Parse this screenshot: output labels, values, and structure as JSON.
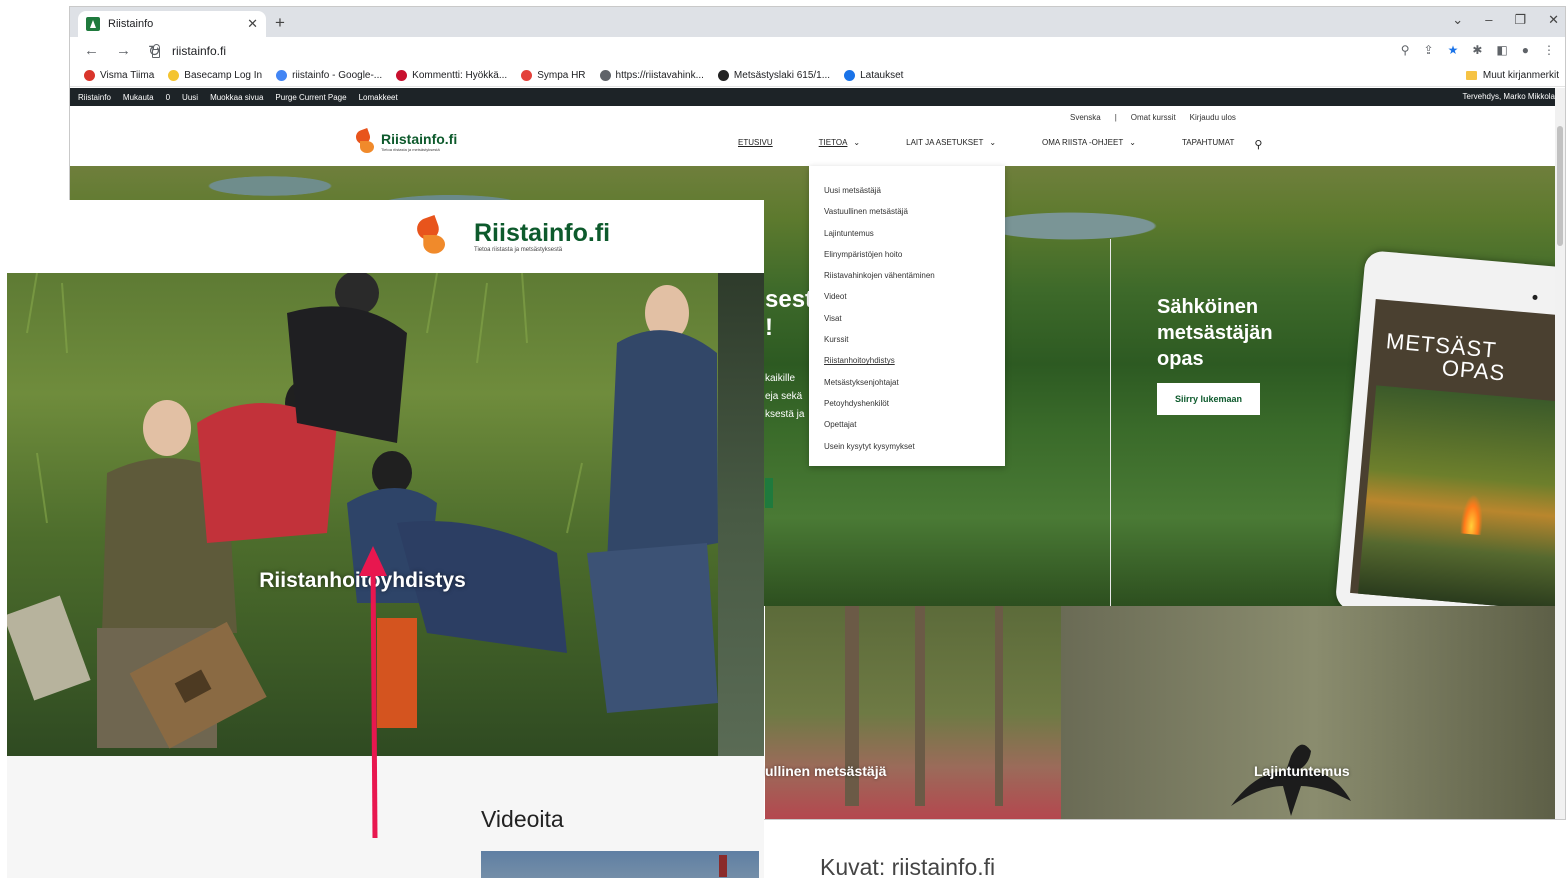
{
  "browser": {
    "tab_title": "Riistainfo",
    "address": "riistainfo.fi",
    "bookmarks": [
      {
        "label": "Visma Tiima",
        "color": "#d9352b"
      },
      {
        "label": "Basecamp Log In",
        "color": "#f4c430"
      },
      {
        "label": "riistainfo - Google-...",
        "color": "#4285f4"
      },
      {
        "label": "Kommentti: Hyökkä...",
        "color": "#c8102e"
      },
      {
        "label": "Sympa HR",
        "color": "#e3413a"
      },
      {
        "label": "https://riistavahink...",
        "color": "#5f6368"
      },
      {
        "label": "Metsästyslaki 615/1...",
        "color": "#222222"
      },
      {
        "label": "Lataukset",
        "color": "#1a73e8"
      }
    ],
    "other_bookmarks": "Muut kirjanmerkit"
  },
  "wp_admin": {
    "items": [
      "Riistainfo",
      "Mukauta",
      "0",
      "Uusi",
      "Muokkaa sivua",
      "Purge Current Page",
      "Lomakkeet"
    ],
    "greeting": "Tervehdys, Marko Mikkola"
  },
  "site": {
    "utility": [
      "Svenska",
      "|",
      "Omat kurssit",
      "Kirjaudu ulos"
    ],
    "logo_text": "Riistainfo.fi",
    "logo_sub": "Tietoa riistasta ja metsästyksestä",
    "nav": [
      {
        "label": "ETUSIVU"
      },
      {
        "label": "TIETOA"
      },
      {
        "label": "LAIT JA ASETUKSET"
      },
      {
        "label": "OMA RIISTA -OHJEET"
      },
      {
        "label": "TAPAHTUMAT"
      }
    ],
    "dropdown": [
      "Uusi metsästäjä",
      "Vastuullinen metsästäjä",
      "Lajintuntemus",
      "Elinympäristöjen hoito",
      "Riistavahinkojen vähentäminen",
      "Videot",
      "Visat",
      "Kurssit",
      "Riistanhoitoyhdistys",
      "Metsästyksenjohtajat",
      "Petoyhdyshenkilöt",
      "Opettajat",
      "Usein kysytyt kysymykset"
    ],
    "hero_partial": "sest",
    "hero_partial_bang": "!",
    "hero_partial_lines": [
      "kaikille",
      "eja sekä",
      "ksestä ja"
    ],
    "hero_title": "Sähköinen metsästäjän opas",
    "hero_button": "Siirry lukemaan",
    "tablet_title_1": "METSÄST",
    "tablet_title_2": "OPAS",
    "lower_left_label": "ullinen metsästäjä",
    "lower_right_label": "Lajintuntemus"
  },
  "foreground": {
    "logo_text": "Riistainfo.fi",
    "logo_sub": "Tietoa riistasta ja metsästyksestä",
    "photo_caption": "Riistanhoitoyhdistys",
    "videos_title": "Videoita"
  },
  "source_note": "Kuvat: riistainfo.fi",
  "colors": {
    "brand_green": "#0d5a2c",
    "brand_orange": "#e8541c",
    "arrow": "#e8174f"
  }
}
